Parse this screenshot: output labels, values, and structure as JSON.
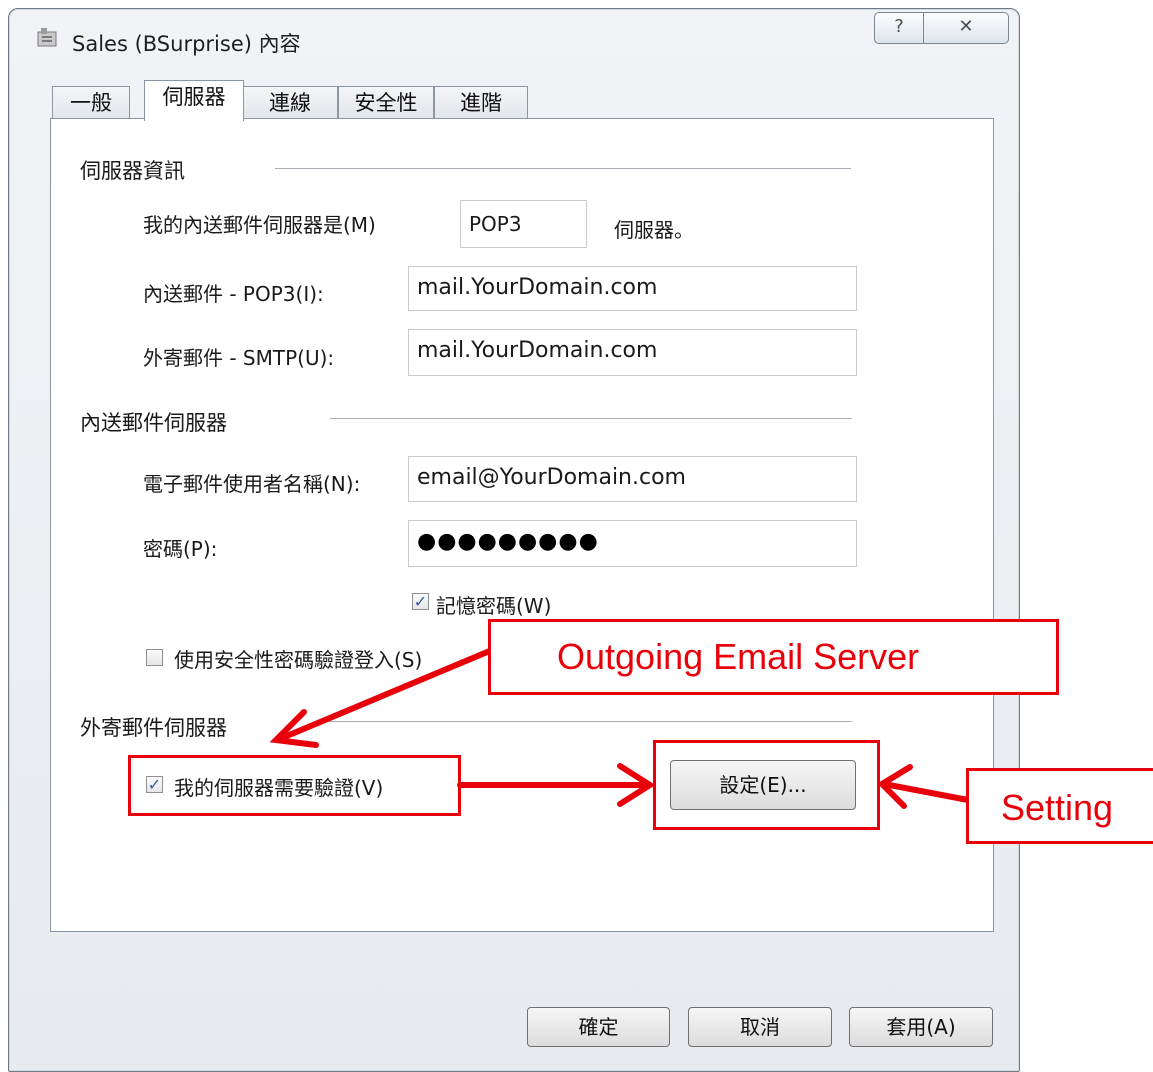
{
  "window": {
    "title": "Sales (BSurprise) 內容",
    "help_glyph": "?",
    "close_glyph": "✕"
  },
  "tabs": [
    {
      "label": "一般"
    },
    {
      "label": "伺服器"
    },
    {
      "label": "連線"
    },
    {
      "label": "安全性"
    },
    {
      "label": "進階"
    }
  ],
  "server_info": {
    "title": "伺服器資訊",
    "incoming_type_label": "我的內送郵件伺服器是(M)",
    "incoming_type_value": "POP3",
    "incoming_type_suffix": "伺服器。",
    "incoming_label": "內送郵件 - POP3(I):",
    "incoming_value": "mail.YourDomain.com",
    "outgoing_label": "外寄郵件 - SMTP(U):",
    "outgoing_value": "mail.YourDomain.com"
  },
  "incoming_server": {
    "title": "內送郵件伺服器",
    "username_label": "電子郵件使用者名稱(N):",
    "username_value": "email@YourDomain.com",
    "password_label": "密碼(P):",
    "password_value": "●●●●●●●●●",
    "remember_label": "記憶密碼(W)",
    "remember_checked": true,
    "spa_label": "使用安全性密碼驗證登入(S)",
    "spa_checked": false
  },
  "outgoing_server": {
    "title": "外寄郵件伺服器",
    "auth_label": "我的伺服器需要驗證(V)",
    "auth_checked": true,
    "settings_button": "設定(E)..."
  },
  "footer": {
    "ok": "確定",
    "cancel": "取消",
    "apply": "套用(A)"
  },
  "annotations": {
    "outgoing_callout": "Outgoing Email Server",
    "setting_callout": "Setting",
    "color": "#e8000b"
  },
  "check_glyph": "✓"
}
